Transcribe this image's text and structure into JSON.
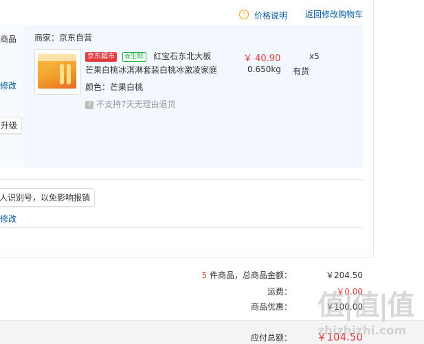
{
  "header": {
    "price_explain": "价格说明",
    "back_to_cart": "返回修改购物车"
  },
  "left_fragments": {
    "goods": "商品",
    "modify": "修改",
    "upgrade": "升级",
    "invoice_tip": "人识别号，以免影响报销",
    "modify2": "修改"
  },
  "order": {
    "vendor": "商家：京东自营",
    "tag_jd": "京东超市",
    "tag_fresh": "生鲜",
    "title_line1": "红宝石东北大板",
    "title_line2": "芒果白桃冰淇淋套装白桃冰激凌家庭",
    "price": "￥ 40.90",
    "quantity": "x5",
    "weight": "0.650kg",
    "stock": "有货",
    "color": "颜色：芒果白桃",
    "no_return": "不支持7天无理由退货"
  },
  "summary": {
    "count": "5",
    "count_suffix": " 件商品，总商品金额：",
    "total_goods": "￥204.50",
    "shipping_label": "运费：",
    "shipping_value": "￥0.00",
    "discount_label": "商品优惠：",
    "discount_value": "￥100.00",
    "payable_label": "应付总额：",
    "payable_value": "￥104.50"
  },
  "watermark": {
    "main": "值|值|值",
    "url": "zhizhizhi.com"
  },
  "colors": {
    "accent_red": "#e4393c",
    "link_blue": "#005aa0",
    "fresh_green": "#27b548"
  }
}
